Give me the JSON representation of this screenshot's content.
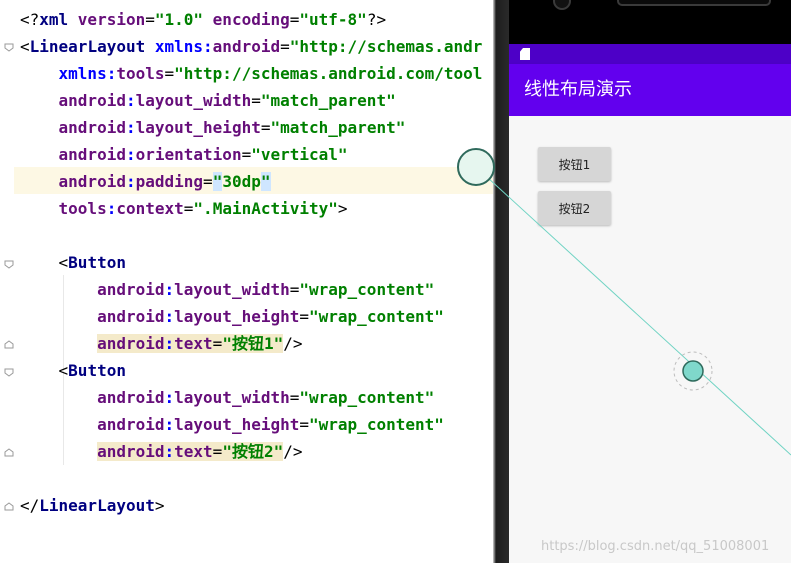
{
  "editor": {
    "lines": [
      {
        "segments": [
          {
            "cls": "t-plain",
            "text": "<?"
          },
          {
            "cls": "t-tag",
            "text": "xml "
          },
          {
            "cls": "t-attr",
            "text": "version"
          },
          {
            "cls": "t-plain",
            "text": "="
          },
          {
            "cls": "t-val",
            "text": "\"1.0\" "
          },
          {
            "cls": "t-attr",
            "text": "encoding"
          },
          {
            "cls": "t-plain",
            "text": "="
          },
          {
            "cls": "t-val",
            "text": "\"utf-8\""
          },
          {
            "cls": "t-plain",
            "text": "?>"
          }
        ]
      },
      {
        "segments": [
          {
            "cls": "t-plain",
            "text": "<"
          },
          {
            "cls": "t-tag",
            "text": "LinearLayout "
          },
          {
            "cls": "t-ns",
            "text": "xmlns:"
          },
          {
            "cls": "t-attr",
            "text": "android"
          },
          {
            "cls": "t-plain",
            "text": "="
          },
          {
            "cls": "t-val",
            "text": "\"http://schemas.andr"
          }
        ]
      },
      {
        "segments": [
          {
            "cls": "t-plain",
            "text": "    "
          },
          {
            "cls": "t-ns",
            "text": "xmlns:"
          },
          {
            "cls": "t-attr",
            "text": "tools"
          },
          {
            "cls": "t-plain",
            "text": "="
          },
          {
            "cls": "t-val",
            "text": "\"http://schemas.android.com/tool"
          }
        ]
      },
      {
        "segments": [
          {
            "cls": "t-plain",
            "text": "    "
          },
          {
            "cls": "t-attr",
            "text": "android"
          },
          {
            "cls": "t-ns",
            "text": ":"
          },
          {
            "cls": "t-attr",
            "text": "layout_width"
          },
          {
            "cls": "t-plain",
            "text": "="
          },
          {
            "cls": "t-val",
            "text": "\"match_parent\""
          }
        ]
      },
      {
        "segments": [
          {
            "cls": "t-plain",
            "text": "    "
          },
          {
            "cls": "t-attr",
            "text": "android"
          },
          {
            "cls": "t-ns",
            "text": ":"
          },
          {
            "cls": "t-attr",
            "text": "layout_height"
          },
          {
            "cls": "t-plain",
            "text": "="
          },
          {
            "cls": "t-val",
            "text": "\"match_parent\""
          }
        ]
      },
      {
        "segments": [
          {
            "cls": "t-plain",
            "text": "    "
          },
          {
            "cls": "t-attr",
            "text": "android"
          },
          {
            "cls": "t-ns",
            "text": ":"
          },
          {
            "cls": "t-attr",
            "text": "orientation"
          },
          {
            "cls": "t-plain",
            "text": "="
          },
          {
            "cls": "t-val",
            "text": "\"vertical\""
          }
        ]
      },
      {
        "segments": [
          {
            "cls": "t-plain",
            "text": "    "
          },
          {
            "cls": "t-attr",
            "text": "android"
          },
          {
            "cls": "t-ns",
            "text": ":"
          },
          {
            "cls": "t-attr",
            "text": "padding"
          },
          {
            "cls": "t-plain",
            "text": "="
          },
          {
            "cls": "t-val hl-quote",
            "text": "\""
          },
          {
            "cls": "t-val",
            "text": "30dp"
          },
          {
            "cls": "t-val hl-quote",
            "text": "\""
          }
        ]
      },
      {
        "segments": [
          {
            "cls": "t-plain",
            "text": "    "
          },
          {
            "cls": "t-attr",
            "text": "tools"
          },
          {
            "cls": "t-ns",
            "text": ":"
          },
          {
            "cls": "t-attr",
            "text": "context"
          },
          {
            "cls": "t-plain",
            "text": "="
          },
          {
            "cls": "t-val",
            "text": "\".MainActivity\""
          },
          {
            "cls": "t-plain",
            "text": ">"
          }
        ]
      },
      {
        "segments": []
      },
      {
        "segments": [
          {
            "cls": "t-plain",
            "text": "    <"
          },
          {
            "cls": "t-tag",
            "text": "Button"
          }
        ]
      },
      {
        "segments": [
          {
            "cls": "t-plain",
            "text": "        "
          },
          {
            "cls": "t-attr",
            "text": "android"
          },
          {
            "cls": "t-ns",
            "text": ":"
          },
          {
            "cls": "t-attr",
            "text": "layout_width"
          },
          {
            "cls": "t-plain",
            "text": "="
          },
          {
            "cls": "t-val",
            "text": "\"wrap_content\""
          }
        ]
      },
      {
        "segments": [
          {
            "cls": "t-plain",
            "text": "        "
          },
          {
            "cls": "t-attr",
            "text": "android"
          },
          {
            "cls": "t-ns",
            "text": ":"
          },
          {
            "cls": "t-attr",
            "text": "layout_height"
          },
          {
            "cls": "t-plain",
            "text": "="
          },
          {
            "cls": "t-val",
            "text": "\"wrap_content\""
          }
        ]
      },
      {
        "segments": [
          {
            "cls": "t-plain",
            "text": "        "
          },
          {
            "cls": "t-attr hl-attr",
            "text": "android"
          },
          {
            "cls": "t-ns hl-attr",
            "text": ":"
          },
          {
            "cls": "t-attr hl-attr",
            "text": "text"
          },
          {
            "cls": "t-plain hl-attr",
            "text": "="
          },
          {
            "cls": "t-val hl-attr",
            "text": "\"按钮1\""
          },
          {
            "cls": "t-plain",
            "text": "/>"
          }
        ]
      },
      {
        "segments": [
          {
            "cls": "t-plain",
            "text": "    <"
          },
          {
            "cls": "t-tag",
            "text": "Button"
          }
        ]
      },
      {
        "segments": [
          {
            "cls": "t-plain",
            "text": "        "
          },
          {
            "cls": "t-attr",
            "text": "android"
          },
          {
            "cls": "t-ns",
            "text": ":"
          },
          {
            "cls": "t-attr",
            "text": "layout_width"
          },
          {
            "cls": "t-plain",
            "text": "="
          },
          {
            "cls": "t-val",
            "text": "\"wrap_content\""
          }
        ]
      },
      {
        "segments": [
          {
            "cls": "t-plain",
            "text": "        "
          },
          {
            "cls": "t-attr",
            "text": "android"
          },
          {
            "cls": "t-ns",
            "text": ":"
          },
          {
            "cls": "t-attr",
            "text": "layout_height"
          },
          {
            "cls": "t-plain",
            "text": "="
          },
          {
            "cls": "t-val",
            "text": "\"wrap_content\""
          }
        ]
      },
      {
        "segments": [
          {
            "cls": "t-plain",
            "text": "        "
          },
          {
            "cls": "t-attr hl-attr",
            "text": "android"
          },
          {
            "cls": "t-ns hl-attr",
            "text": ":"
          },
          {
            "cls": "t-attr hl-attr",
            "text": "text"
          },
          {
            "cls": "t-plain hl-attr",
            "text": "="
          },
          {
            "cls": "t-val hl-attr",
            "text": "\"按钮2\""
          },
          {
            "cls": "t-plain",
            "text": "/>"
          }
        ]
      },
      {
        "segments": []
      },
      {
        "segments": [
          {
            "cls": "t-plain",
            "text": "</"
          },
          {
            "cls": "t-tag",
            "text": "LinearLayout"
          },
          {
            "cls": "t-plain",
            "text": ">"
          }
        ]
      }
    ]
  },
  "preview": {
    "app_title": "线性布局演示",
    "buttons": [
      {
        "label": "按钮1"
      },
      {
        "label": "按钮2"
      }
    ],
    "watermark": "https://blog.csdn.net/qq_51008001"
  },
  "colors": {
    "status_bar": "#4d00c7",
    "action_bar": "#6200ee",
    "connector": "#6fd3c3",
    "connector_handle": "#7fd8cb"
  }
}
